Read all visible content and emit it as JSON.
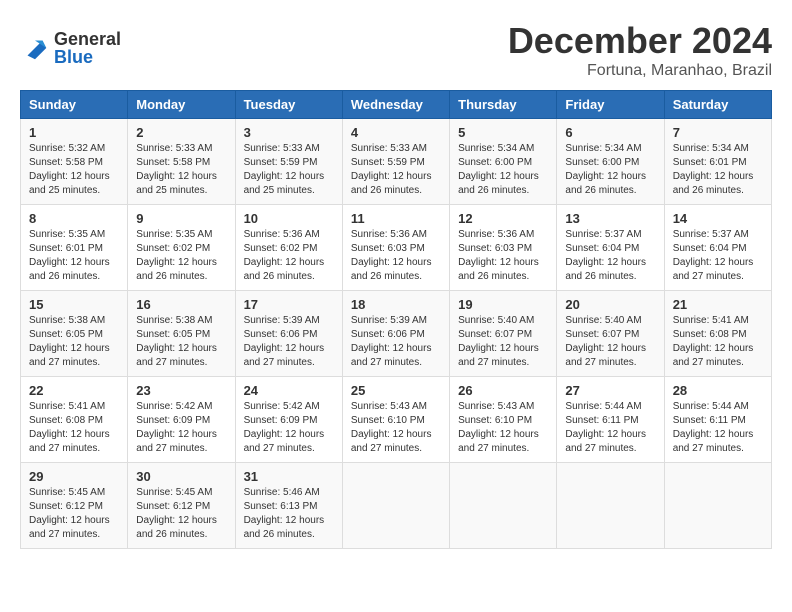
{
  "logo": {
    "general": "General",
    "blue": "Blue"
  },
  "title": "December 2024",
  "location": "Fortuna, Maranhao, Brazil",
  "days_of_week": [
    "Sunday",
    "Monday",
    "Tuesday",
    "Wednesday",
    "Thursday",
    "Friday",
    "Saturday"
  ],
  "weeks": [
    [
      {
        "day": "1",
        "info": "Sunrise: 5:32 AM\nSunset: 5:58 PM\nDaylight: 12 hours\nand 25 minutes."
      },
      {
        "day": "2",
        "info": "Sunrise: 5:33 AM\nSunset: 5:58 PM\nDaylight: 12 hours\nand 25 minutes."
      },
      {
        "day": "3",
        "info": "Sunrise: 5:33 AM\nSunset: 5:59 PM\nDaylight: 12 hours\nand 25 minutes."
      },
      {
        "day": "4",
        "info": "Sunrise: 5:33 AM\nSunset: 5:59 PM\nDaylight: 12 hours\nand 26 minutes."
      },
      {
        "day": "5",
        "info": "Sunrise: 5:34 AM\nSunset: 6:00 PM\nDaylight: 12 hours\nand 26 minutes."
      },
      {
        "day": "6",
        "info": "Sunrise: 5:34 AM\nSunset: 6:00 PM\nDaylight: 12 hours\nand 26 minutes."
      },
      {
        "day": "7",
        "info": "Sunrise: 5:34 AM\nSunset: 6:01 PM\nDaylight: 12 hours\nand 26 minutes."
      }
    ],
    [
      {
        "day": "8",
        "info": "Sunrise: 5:35 AM\nSunset: 6:01 PM\nDaylight: 12 hours\nand 26 minutes."
      },
      {
        "day": "9",
        "info": "Sunrise: 5:35 AM\nSunset: 6:02 PM\nDaylight: 12 hours\nand 26 minutes."
      },
      {
        "day": "10",
        "info": "Sunrise: 5:36 AM\nSunset: 6:02 PM\nDaylight: 12 hours\nand 26 minutes."
      },
      {
        "day": "11",
        "info": "Sunrise: 5:36 AM\nSunset: 6:03 PM\nDaylight: 12 hours\nand 26 minutes."
      },
      {
        "day": "12",
        "info": "Sunrise: 5:36 AM\nSunset: 6:03 PM\nDaylight: 12 hours\nand 26 minutes."
      },
      {
        "day": "13",
        "info": "Sunrise: 5:37 AM\nSunset: 6:04 PM\nDaylight: 12 hours\nand 26 minutes."
      },
      {
        "day": "14",
        "info": "Sunrise: 5:37 AM\nSunset: 6:04 PM\nDaylight: 12 hours\nand 27 minutes."
      }
    ],
    [
      {
        "day": "15",
        "info": "Sunrise: 5:38 AM\nSunset: 6:05 PM\nDaylight: 12 hours\nand 27 minutes."
      },
      {
        "day": "16",
        "info": "Sunrise: 5:38 AM\nSunset: 6:05 PM\nDaylight: 12 hours\nand 27 minutes."
      },
      {
        "day": "17",
        "info": "Sunrise: 5:39 AM\nSunset: 6:06 PM\nDaylight: 12 hours\nand 27 minutes."
      },
      {
        "day": "18",
        "info": "Sunrise: 5:39 AM\nSunset: 6:06 PM\nDaylight: 12 hours\nand 27 minutes."
      },
      {
        "day": "19",
        "info": "Sunrise: 5:40 AM\nSunset: 6:07 PM\nDaylight: 12 hours\nand 27 minutes."
      },
      {
        "day": "20",
        "info": "Sunrise: 5:40 AM\nSunset: 6:07 PM\nDaylight: 12 hours\nand 27 minutes."
      },
      {
        "day": "21",
        "info": "Sunrise: 5:41 AM\nSunset: 6:08 PM\nDaylight: 12 hours\nand 27 minutes."
      }
    ],
    [
      {
        "day": "22",
        "info": "Sunrise: 5:41 AM\nSunset: 6:08 PM\nDaylight: 12 hours\nand 27 minutes."
      },
      {
        "day": "23",
        "info": "Sunrise: 5:42 AM\nSunset: 6:09 PM\nDaylight: 12 hours\nand 27 minutes."
      },
      {
        "day": "24",
        "info": "Sunrise: 5:42 AM\nSunset: 6:09 PM\nDaylight: 12 hours\nand 27 minutes."
      },
      {
        "day": "25",
        "info": "Sunrise: 5:43 AM\nSunset: 6:10 PM\nDaylight: 12 hours\nand 27 minutes."
      },
      {
        "day": "26",
        "info": "Sunrise: 5:43 AM\nSunset: 6:10 PM\nDaylight: 12 hours\nand 27 minutes."
      },
      {
        "day": "27",
        "info": "Sunrise: 5:44 AM\nSunset: 6:11 PM\nDaylight: 12 hours\nand 27 minutes."
      },
      {
        "day": "28",
        "info": "Sunrise: 5:44 AM\nSunset: 6:11 PM\nDaylight: 12 hours\nand 27 minutes."
      }
    ],
    [
      {
        "day": "29",
        "info": "Sunrise: 5:45 AM\nSunset: 6:12 PM\nDaylight: 12 hours\nand 27 minutes."
      },
      {
        "day": "30",
        "info": "Sunrise: 5:45 AM\nSunset: 6:12 PM\nDaylight: 12 hours\nand 26 minutes."
      },
      {
        "day": "31",
        "info": "Sunrise: 5:46 AM\nSunset: 6:13 PM\nDaylight: 12 hours\nand 26 minutes."
      },
      {
        "day": "",
        "info": ""
      },
      {
        "day": "",
        "info": ""
      },
      {
        "day": "",
        "info": ""
      },
      {
        "day": "",
        "info": ""
      }
    ]
  ]
}
